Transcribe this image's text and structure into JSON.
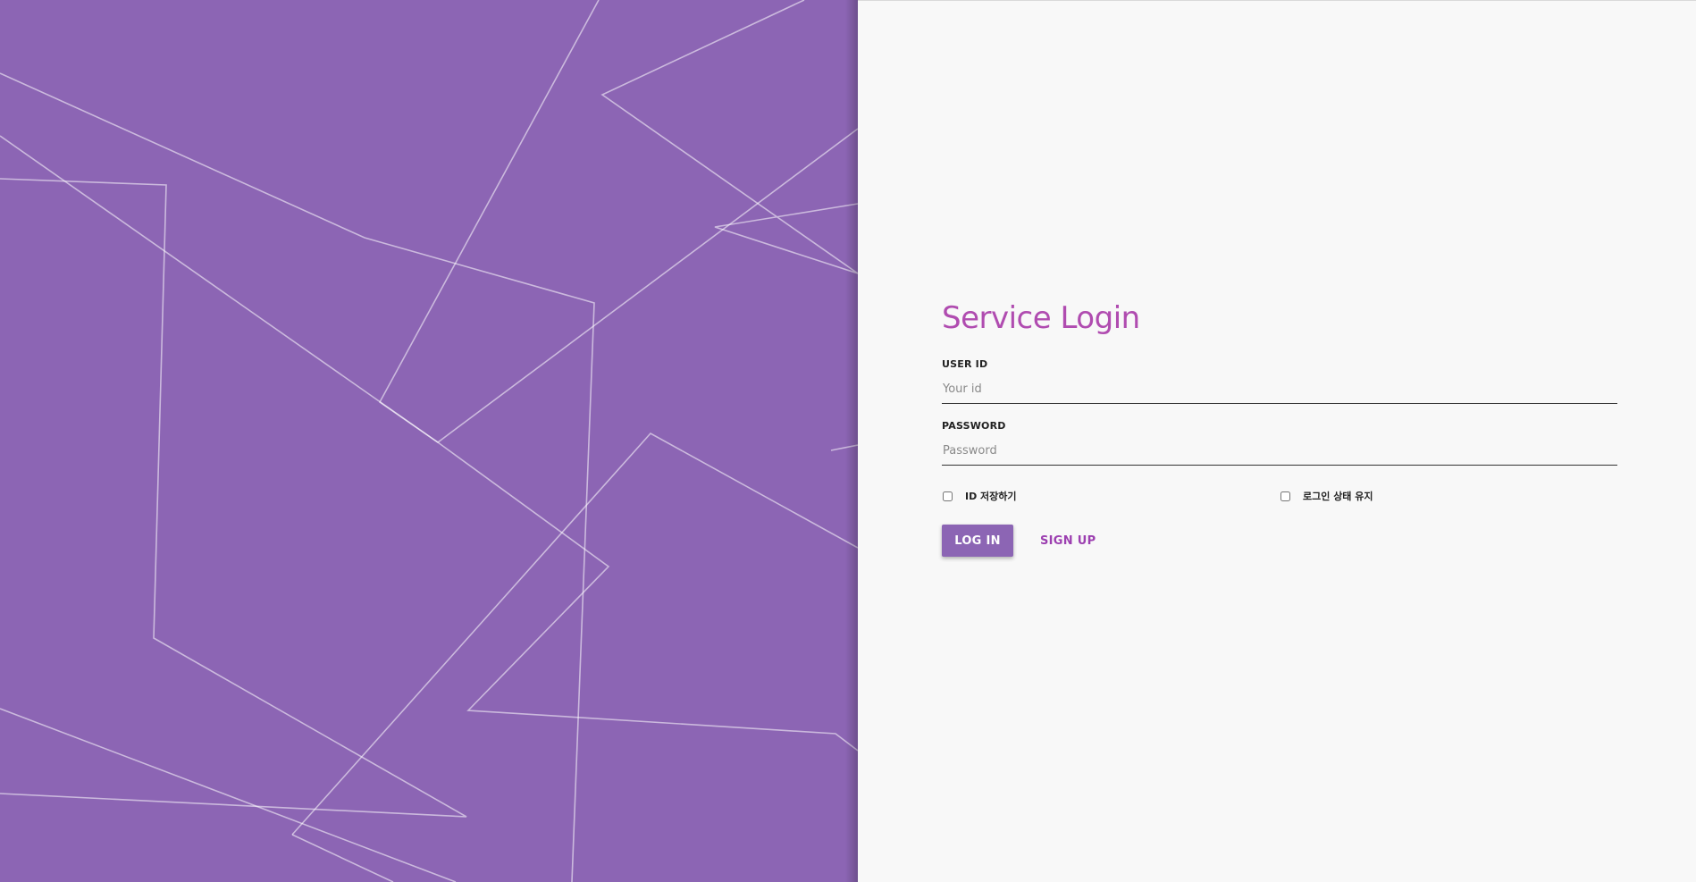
{
  "brand": {
    "primary_color": "#8c65b4",
    "title_color": "#b04cb0",
    "link_color": "#9c3fb0"
  },
  "background": {
    "icon": "geometric-lines-pattern"
  },
  "login": {
    "title": "Service Login",
    "user_id": {
      "label": "USER ID",
      "placeholder": "Your id",
      "value": ""
    },
    "password": {
      "label": "PASSWORD",
      "placeholder": "Password",
      "value": ""
    },
    "options": {
      "save_id_label": "ID 저장하기",
      "save_id_checked": false,
      "keep_login_label": "로그인 상태 유지",
      "keep_login_checked": false
    },
    "login_button": "LOG IN",
    "signup_link": "SIGN UP"
  }
}
